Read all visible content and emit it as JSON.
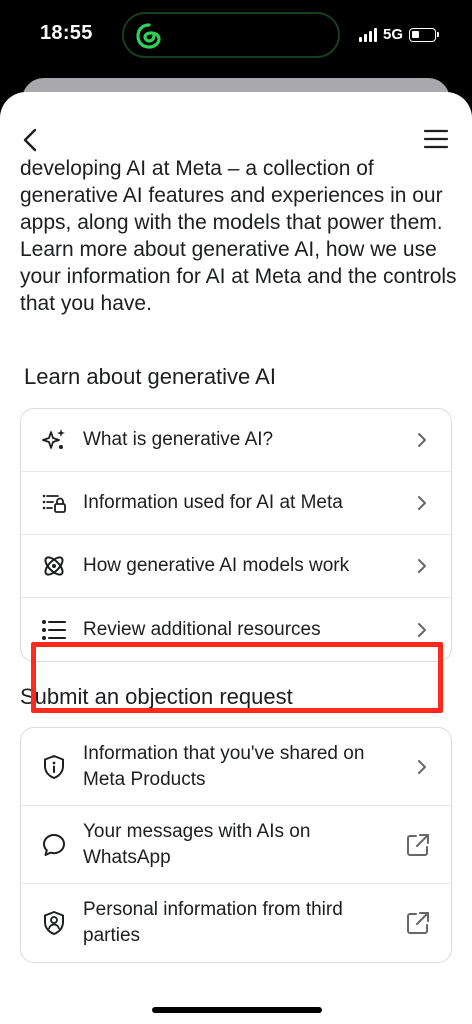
{
  "status_bar": {
    "time": "18:55",
    "network": "5G",
    "island_app_icon": "threads-green-icon"
  },
  "nav": {
    "back_icon": "chevron-left-icon",
    "menu_icon": "hamburger-menu-icon"
  },
  "intro": {
    "text": "Learn how we use your information as we're developing AI at Meta – a collection of generative AI features and experiences in our apps, along with the models that power them. Learn more about generative AI, how we use your information for AI at Meta and the controls that you have."
  },
  "learn_section": {
    "title": "Learn about generative AI",
    "items": [
      {
        "label": "What is generative AI?",
        "icon": "sparkles-icon"
      },
      {
        "label": "Information used for AI at Meta",
        "icon": "info-lock-list-icon"
      },
      {
        "label": "How generative AI models work",
        "icon": "atom-icon"
      },
      {
        "label": "Review additional resources",
        "icon": "bullet-list-icon"
      }
    ]
  },
  "submit_section": {
    "title": "Submit an objection request",
    "items": [
      {
        "label": "Information that you've shared on Meta Products",
        "icon": "shield-info-icon",
        "action": "chevron-right-icon"
      },
      {
        "label": "Your messages with AIs on WhatsApp",
        "icon": "chat-bubble-icon",
        "action": "external-link-icon"
      },
      {
        "label": "Personal information from third parties",
        "icon": "shield-person-icon",
        "action": "external-link-icon"
      }
    ]
  },
  "colors": {
    "highlight": "#ff2a1d",
    "text": "#1c1e21",
    "divider": "#e4e6eb",
    "island_border": "#173d22",
    "island_icon": "#30d158"
  }
}
